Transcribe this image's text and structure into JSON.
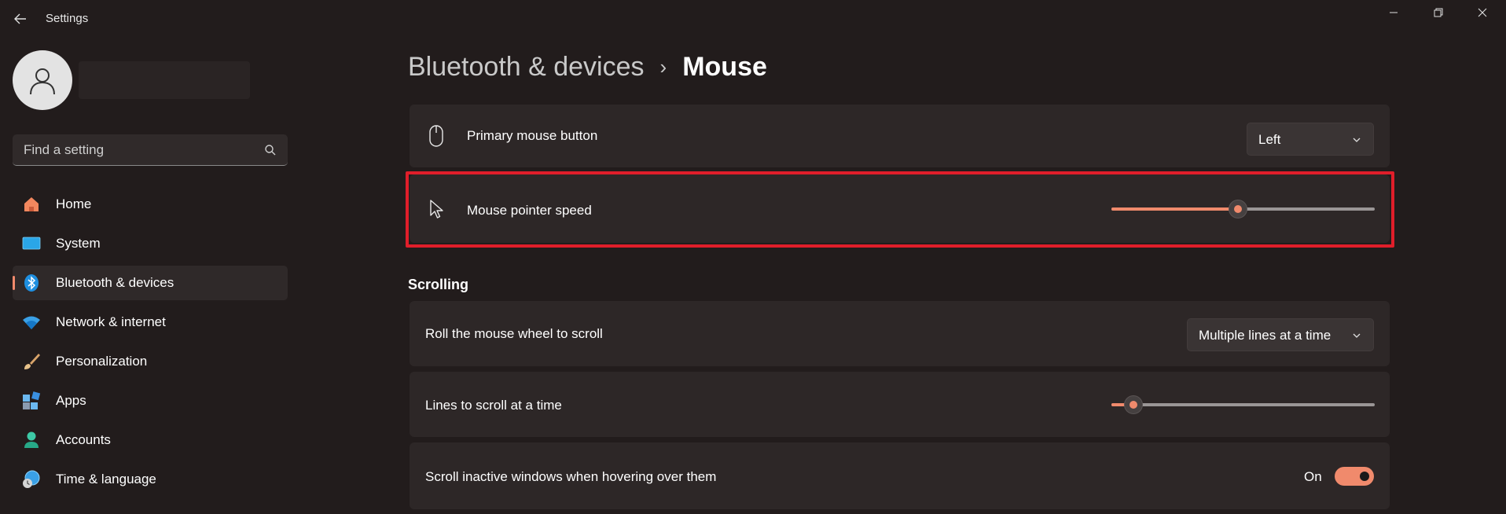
{
  "window": {
    "title": "Settings",
    "controls": [
      "minimize-icon",
      "restore-icon",
      "close-icon"
    ]
  },
  "user": {
    "name": ""
  },
  "search": {
    "placeholder": "Find a setting"
  },
  "sidebar": {
    "items": [
      {
        "label": "Home",
        "icon": "home-icon",
        "active": false
      },
      {
        "label": "System",
        "icon": "system-icon",
        "active": false
      },
      {
        "label": "Bluetooth & devices",
        "icon": "bluetooth-icon",
        "active": true
      },
      {
        "label": "Network & internet",
        "icon": "wifi-icon",
        "active": false
      },
      {
        "label": "Personalization",
        "icon": "brush-icon",
        "active": false
      },
      {
        "label": "Apps",
        "icon": "apps-icon",
        "active": false
      },
      {
        "label": "Accounts",
        "icon": "accounts-icon",
        "active": false
      },
      {
        "label": "Time & language",
        "icon": "globe-clock-icon",
        "active": false
      }
    ]
  },
  "breadcrumb": {
    "parent": "Bluetooth & devices",
    "separator": "›",
    "current": "Mouse"
  },
  "settings": {
    "primary_button": {
      "label": "Primary mouse button",
      "value": "Left"
    },
    "pointer_speed": {
      "label": "Mouse pointer speed",
      "value_fraction": 0.48
    },
    "scrolling_header": "Scrolling",
    "wheel_scroll": {
      "label": "Roll the mouse wheel to scroll",
      "value": "Multiple lines at a time"
    },
    "lines_to_scroll": {
      "label": "Lines to scroll at a time",
      "value_fraction": 0.05
    },
    "inactive_scroll": {
      "label": "Scroll inactive windows when hovering over them",
      "state": "On"
    }
  },
  "colors": {
    "accent": "#f08a6c",
    "highlight": "#e01e2a",
    "background": "#221c1c",
    "card": "#2d2727"
  }
}
